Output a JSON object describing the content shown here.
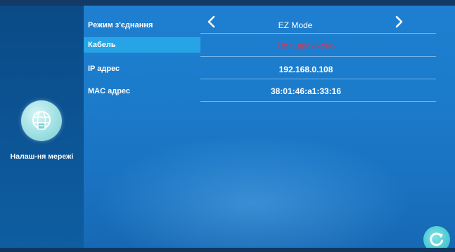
{
  "sidebar": {
    "network_settings_label": "Налаш-ня мережі",
    "network_icon": "network-settings-icon"
  },
  "settings": {
    "connection_mode": {
      "label": "Режим з'єднання",
      "value": "EZ Mode"
    },
    "cable": {
      "label": "Кабель",
      "value": "Не підключено",
      "status_color": "#e2314a"
    },
    "ip": {
      "label": "IP адрес",
      "value": "192.168.0.108"
    },
    "mac": {
      "label": "MAC адрес",
      "value": "38:01:46:a1:33:16"
    }
  },
  "icons": {
    "prev": "chevron-left-icon",
    "next": "chevron-right-icon",
    "refresh": "refresh-icon"
  }
}
